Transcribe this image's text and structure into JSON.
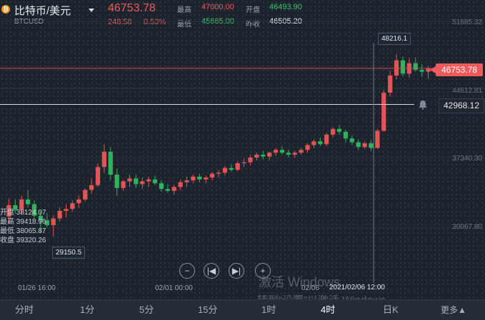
{
  "header": {
    "title": "比特币/美元",
    "symbol": "BTCUSD",
    "price": "46753.78",
    "change": "248.58",
    "change_pct": "0.53%",
    "high_label": "最高",
    "high_value": "47000.00",
    "open_label": "开盘",
    "open_value": "46493.90",
    "low_label": "最低",
    "low_value": "45665.00",
    "prev_close_label": "昨收",
    "prev_close_value": "46505.20"
  },
  "chart_data": {
    "type": "candlestick",
    "x": [
      "01/26 16:00",
      "02/01 00:00",
      "02/06"
    ],
    "right_axis": [
      "51685.32",
      "44612.81",
      "37340.30",
      "30067.80"
    ],
    "price_tag": "46753.78",
    "alert_price": "42968.12",
    "annot_high": "48216.1",
    "annot_low": "29150.5",
    "ohlc": {
      "open_label": "开盘",
      "open": "38124.07",
      "high_label": "最高",
      "high": "39418.96",
      "low_label": "最低",
      "low": "38065.87",
      "close_label": "收盘",
      "close": "39320.26"
    },
    "candles": [
      [
        31200,
        33100,
        30500,
        32400
      ],
      [
        32400,
        33000,
        31500,
        31900
      ],
      [
        31900,
        33400,
        31400,
        33000
      ],
      [
        33000,
        34000,
        32200,
        32500
      ],
      [
        32500,
        32900,
        31000,
        31300
      ],
      [
        31300,
        31800,
        29500,
        30800
      ],
      [
        30800,
        31600,
        30100,
        30300
      ],
      [
        30300,
        31300,
        29150,
        31000
      ],
      [
        31000,
        32200,
        30700,
        31800
      ],
      [
        31800,
        32500,
        31100,
        32000
      ],
      [
        32000,
        32900,
        31700,
        32600
      ],
      [
        32600,
        33400,
        32100,
        33000
      ],
      [
        33000,
        34200,
        32800,
        34000
      ],
      [
        34000,
        35200,
        33600,
        34500
      ],
      [
        34500,
        36800,
        34300,
        36400
      ],
      [
        36400,
        38800,
        35800,
        38000
      ],
      [
        38000,
        38500,
        35000,
        35600
      ],
      [
        35600,
        36200,
        33400,
        34200
      ],
      [
        34200,
        35100,
        33900,
        34900
      ],
      [
        34900,
        35600,
        34300,
        35200
      ],
      [
        35200,
        35600,
        34200,
        34600
      ],
      [
        34600,
        35300,
        34100,
        34900
      ],
      [
        34900,
        35400,
        34300,
        35100
      ],
      [
        35100,
        35500,
        34500,
        34700
      ],
      [
        34700,
        35000,
        33800,
        34100
      ],
      [
        34100,
        34600,
        33700,
        33900
      ],
      [
        33900,
        34500,
        33500,
        34300
      ],
      [
        34300,
        35100,
        34000,
        34800
      ],
      [
        34800,
        35400,
        34300,
        35000
      ],
      [
        35000,
        35600,
        34700,
        35400
      ],
      [
        35400,
        35700,
        34800,
        35100
      ],
      [
        35100,
        35500,
        34700,
        35300
      ],
      [
        35300,
        35900,
        35000,
        35700
      ],
      [
        35700,
        36100,
        35300,
        35800
      ],
      [
        35800,
        36500,
        35500,
        36300
      ],
      [
        36300,
        36700,
        35900,
        36100
      ],
      [
        36100,
        37000,
        36000,
        36800
      ],
      [
        36800,
        37300,
        36400,
        36900
      ],
      [
        36900,
        37700,
        36600,
        37400
      ],
      [
        37400,
        37900,
        37100,
        37700
      ],
      [
        37700,
        38100,
        37200,
        37500
      ],
      [
        37500,
        38000,
        37100,
        37900
      ],
      [
        37900,
        38400,
        37600,
        38200
      ],
      [
        38200,
        38600,
        37700,
        37900
      ],
      [
        37900,
        38200,
        37400,
        37700
      ],
      [
        37700,
        38100,
        37400,
        37900
      ],
      [
        37900,
        38400,
        37700,
        38200
      ],
      [
        38200,
        38900,
        37900,
        38700
      ],
      [
        38700,
        39300,
        38400,
        39100
      ],
      [
        39100,
        39500,
        38600,
        38800
      ],
      [
        38800,
        40000,
        38600,
        39800
      ],
      [
        39800,
        40600,
        39500,
        40400
      ],
      [
        40400,
        40800,
        39800,
        40100
      ],
      [
        40100,
        40300,
        39000,
        39400
      ],
      [
        39400,
        39700,
        38700,
        39000
      ],
      [
        39000,
        39300,
        38200,
        38500
      ],
      [
        38500,
        39100,
        38300,
        38900
      ],
      [
        38900,
        39200,
        38100,
        38400
      ],
      [
        38400,
        40400,
        38300,
        40200
      ],
      [
        40200,
        44500,
        40100,
        44200
      ],
      [
        44200,
        46500,
        43800,
        46000
      ],
      [
        46000,
        48216,
        45600,
        47600
      ],
      [
        47600,
        48000,
        45900,
        46200
      ],
      [
        46200,
        47800,
        45800,
        47300
      ],
      [
        47300,
        47900,
        46400,
        46600
      ],
      [
        46600,
        47200,
        45900,
        46400
      ],
      [
        46400,
        47000,
        45665,
        46750
      ]
    ]
  },
  "controls": {
    "zoom_out": "−",
    "prev": "|◀",
    "next": "▶|",
    "zoom_in": "+"
  },
  "tooltip": {
    "date": "2021/02/06 12:00"
  },
  "watermark": {
    "line1": "激活 Windows",
    "line2": "转到“设置”以激活 Windows。"
  },
  "tabs": [
    {
      "label": "分时"
    },
    {
      "label": "1分"
    },
    {
      "label": "5分"
    },
    {
      "label": "15分"
    },
    {
      "label": "1时"
    },
    {
      "label": "4时"
    },
    {
      "label": "日K"
    }
  ],
  "more": "更多"
}
